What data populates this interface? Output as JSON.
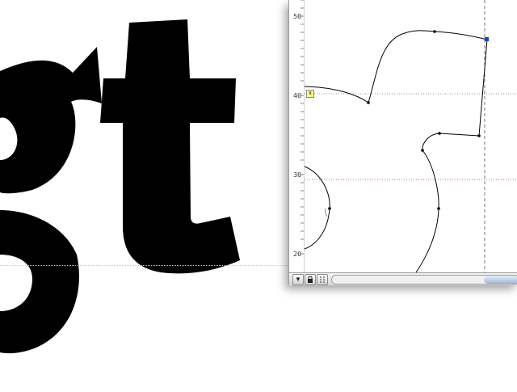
{
  "preview": {
    "glyphs": "gt"
  },
  "editor": {
    "ruler_labels": [
      "50",
      "40",
      "30",
      "20"
    ],
    "anchor_marker": "x",
    "status_bar": {
      "menu_icon": "triangle-down-icon",
      "lock_icon": "lock-icon",
      "grid_icon": "dots-icon"
    }
  },
  "colors": {
    "guide_red": "#e06060",
    "guide_dotted": "#999999",
    "outline": "#000000",
    "selected_point": "#2040c0"
  }
}
